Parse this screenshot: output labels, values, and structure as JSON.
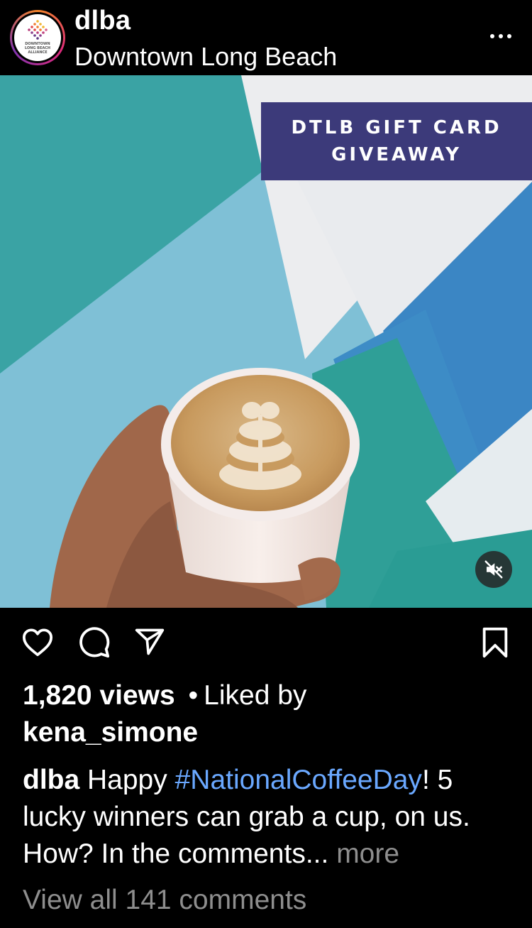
{
  "post": {
    "username": "dlba",
    "location": "Downtown Long Beach",
    "avatar_text_lines": [
      "DOWNTOWN",
      "LONG BEACH",
      "ALLIANCE"
    ]
  },
  "media": {
    "banner_line1": "DTLB GIFT CARD",
    "banner_line2": "GIVEAWAY",
    "mute_icon": "speaker-muted-icon"
  },
  "actions": {
    "like_icon": "heart-icon",
    "comment_icon": "comment-bubble-icon",
    "share_icon": "paper-plane-icon",
    "save_icon": "bookmark-icon"
  },
  "stats": {
    "views": "1,820 views",
    "separator": "•",
    "liked_by_prefix": "Liked by",
    "liked_by_user": "kena_simone"
  },
  "caption": {
    "author": "dlba",
    "text_start": "Happy",
    "hashtag": "#NationalCoffeeDay",
    "text_rest": "! 5 lucky winners can grab a cup, on us. How? In the comments...",
    "more": "more"
  },
  "comments_link": "View all 141 comments",
  "colors": {
    "background": "#000000",
    "banner": "#3c3a7a",
    "hashtag": "#6aa8ff",
    "muted_text": "#8e8e8e"
  }
}
